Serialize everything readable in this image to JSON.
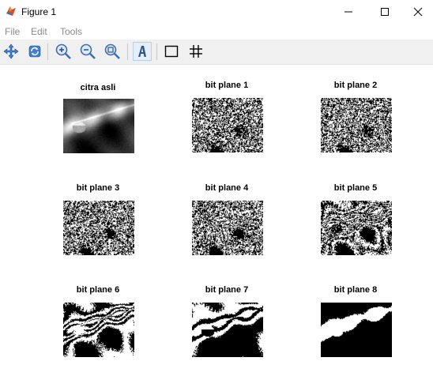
{
  "window": {
    "title": "Figure 1",
    "icon": "matlab-figure-icon"
  },
  "title_buttons": [
    "minimize-icon",
    "maximize-icon",
    "close-icon"
  ],
  "menu": {
    "items": [
      {
        "label": "File"
      },
      {
        "label": "Edit"
      },
      {
        "label": "Tools"
      }
    ]
  },
  "toolbar": {
    "tools": [
      {
        "name": "pan-icon"
      },
      {
        "name": "rotate-icon"
      },
      {
        "name": "zoom-in-icon"
      },
      {
        "name": "zoom-out-icon"
      },
      {
        "name": "zoom-fit-icon"
      },
      {
        "name": "insert-text-icon",
        "active": true
      },
      {
        "name": "box-icon"
      },
      {
        "name": "grid-icon"
      }
    ]
  },
  "subplots": [
    {
      "title": "citra asli",
      "kind": "grayscale"
    },
    {
      "title": "bit plane 1",
      "kind": "binary"
    },
    {
      "title": "bit plane 2",
      "kind": "binary"
    },
    {
      "title": "bit plane 3",
      "kind": "binary"
    },
    {
      "title": "bit plane 4",
      "kind": "binary"
    },
    {
      "title": "bit plane 5",
      "kind": "binary"
    },
    {
      "title": "bit plane 6",
      "kind": "binary"
    },
    {
      "title": "bit plane 7",
      "kind": "binary"
    },
    {
      "title": "bit plane 8",
      "kind": "binary"
    }
  ],
  "colors": {
    "titlebar": "#ffffff",
    "toolbar": "#f0f0f0",
    "menu_text": "#8a8a8a",
    "figure_bg": "#ffffff"
  }
}
